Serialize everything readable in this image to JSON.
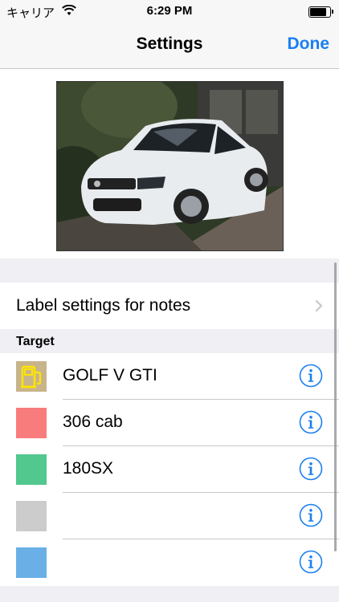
{
  "status_bar": {
    "carrier": "キャリア",
    "time": "6:29 PM",
    "battery_level": 0.9
  },
  "nav": {
    "title": "Settings",
    "done_label": "Done"
  },
  "label_settings": {
    "label": "Label settings for notes"
  },
  "target_section": {
    "header": "Target",
    "items": [
      {
        "name": "GOLF V GTI",
        "color": "#c8b48a",
        "icon": "fuel-pump-icon"
      },
      {
        "name": "306 cab",
        "color": "#f97c7c",
        "icon": null
      },
      {
        "name": "180SX",
        "color": "#52c78e",
        "icon": null
      },
      {
        "name": "",
        "color": "#cccccc",
        "icon": null
      },
      {
        "name": "",
        "color": "#6ab0e6",
        "icon": null
      }
    ]
  },
  "colors": {
    "accent": "#1a7ff1",
    "background": "#efeff4"
  }
}
